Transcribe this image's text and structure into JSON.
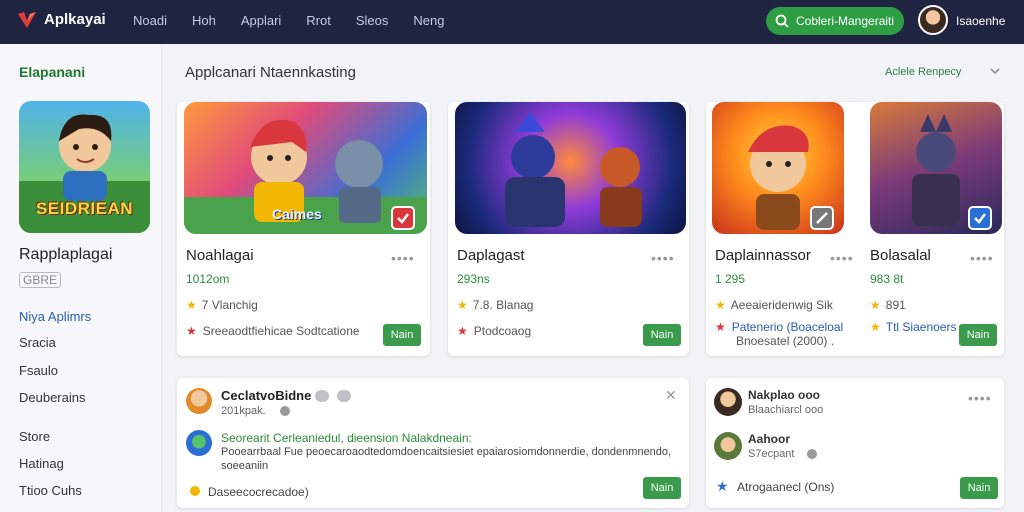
{
  "header": {
    "brand": "Aplkayai",
    "nav": [
      "Noadi",
      "Hoh",
      "Applari",
      "Rrot",
      "Sleos",
      "Neng"
    ],
    "cta_label": "Cobleri-Mangeraiti",
    "user_name": "Isaoenhe"
  },
  "sidebar": {
    "title": "Elapanani",
    "feature_caption": "SEIDRIEAN",
    "feature_name": "Rapplaplagai",
    "feature_sub": "GBRE",
    "links": [
      "Niya Aplimrs",
      "Sracia",
      "Fsaulo",
      "Deuberains",
      "Store",
      "Hatinag",
      "Ttioo Cuhs"
    ]
  },
  "main": {
    "title": "Applcanari Ntaennkasting",
    "filter_label": "Aclele Renpecy"
  },
  "cards": [
    {
      "thumb_label": "Caimes",
      "name": "Noahlagai",
      "meta": "1012om",
      "rating": "7 Vlanchig",
      "info": "Sreeaodtfiehicae Sodtcatione",
      "button": "Nain"
    },
    {
      "name": "Daplagast",
      "meta": "293ns",
      "rating": "7.8. Blanag",
      "info": "Ptodcoaog",
      "button": "Nain"
    },
    {
      "name": "Daplainnassor",
      "meta": "1 295",
      "rating": "Aeeaieridenwig Sik",
      "info_blue": "Patenerio (Boaceloal",
      "info": "Bnoesatel (2000) .",
      "button": "Nain"
    },
    {
      "name": "Bolasalal",
      "meta": "983 8t",
      "rating": "891",
      "info_blue": "Ttl Siaenoers",
      "button": "Nain"
    }
  ],
  "bottom_left": {
    "title": "CeclatvoBidne",
    "sub": "201kpak.",
    "headline": "Seorearit Cerleaniedul, dieension Nalakdneain:",
    "body": "Pooearrbaal Fue peoecaroaodtedomdoencaitsiesiet epaiarosiomdonnerdie, dondenmnendo, 2.",
    "body2": "soeeaniin",
    "footer": "Daseecocrecadoe)",
    "button": "Nain"
  },
  "bottom_right": {
    "item1_title": "Nakplao ooo",
    "item1_sub": "Blaachiarcl ooo",
    "item2_title": "Aahoor",
    "item2_sub": "S7ecpant",
    "footer": "Atrogaanecl (Ons)",
    "button": "Nain"
  }
}
